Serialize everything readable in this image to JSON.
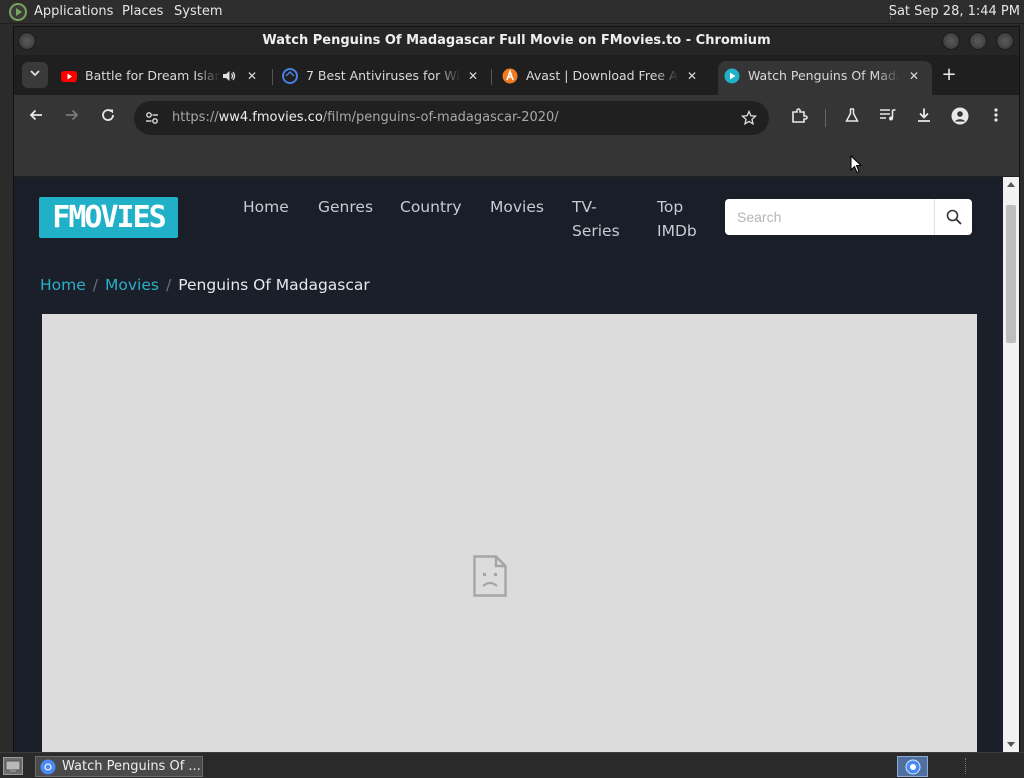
{
  "top_panel": {
    "menus": [
      "Applications",
      "Places",
      "System"
    ],
    "clock": "Sat Sep 28,  1:44 PM"
  },
  "window": {
    "title": "Watch Penguins Of Madagascar Full Movie on FMovies.to - Chromium"
  },
  "tabs": [
    {
      "title": "Battle for Dream Island",
      "favicon": "youtube-icon",
      "audio": true,
      "active": false
    },
    {
      "title": "7 Best Antiviruses for Windows",
      "favicon": "antivirus-site-icon",
      "audio": false,
      "active": false
    },
    {
      "title": "Avast | Download Free Antivirus",
      "favicon": "avast-icon",
      "audio": false,
      "active": false
    },
    {
      "title": "Watch Penguins Of Madagascar",
      "favicon": "fmovies-icon",
      "audio": false,
      "active": true
    }
  ],
  "toolbar": {
    "url_scheme": "https://",
    "url_host": "ww4.fmovies.co",
    "url_path": "/film/penguins-of-madagascar-2020/"
  },
  "site": {
    "logo": "FMOVIES",
    "nav": [
      {
        "line1": "Home",
        "line2": ""
      },
      {
        "line1": "Genres",
        "line2": ""
      },
      {
        "line1": "Country",
        "line2": ""
      },
      {
        "line1": "Movies",
        "line2": ""
      },
      {
        "line1": "TV-",
        "line2": "Series"
      },
      {
        "line1": "Top",
        "line2": "IMDb"
      }
    ],
    "search_placeholder": "Search",
    "breadcrumb": {
      "home": "Home",
      "movies": "Movies",
      "current": "Penguins Of Madagascar",
      "separator": "/"
    },
    "accent_color": "#20b0c8"
  },
  "taskbar": {
    "task_label": "Watch Penguins Of ..."
  }
}
